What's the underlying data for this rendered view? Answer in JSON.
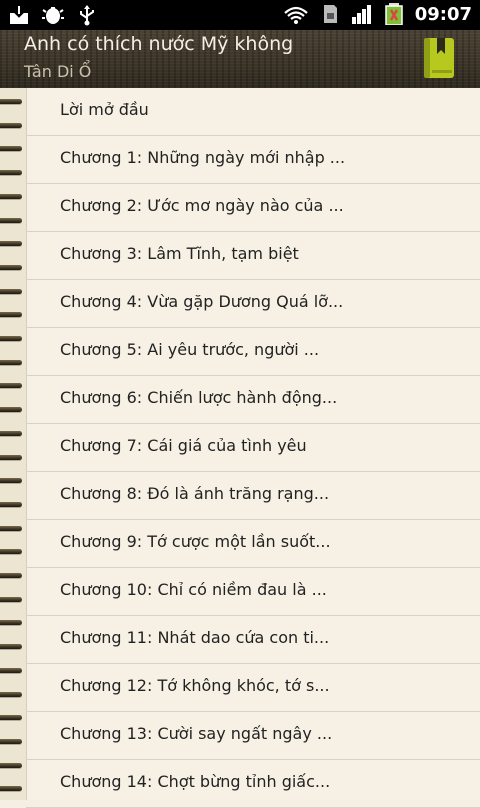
{
  "status_bar": {
    "icons_left": [
      "download-icon",
      "android-debug-icon",
      "usb-icon"
    ],
    "icons_right": [
      "wifi-icon",
      "sd-card-icon",
      "signal-icon",
      "battery-charging-icon"
    ],
    "time": "09:07"
  },
  "header": {
    "title": "Anh có thích nước Mỹ không",
    "author": "Tân Di Ổ",
    "bookmark_icon": "bookmark-book-icon",
    "accent_color": "#b7c81e"
  },
  "chapters": [
    "Lời mở đầu",
    "Chương 1: Những ngày mới nhập ...",
    "Chương 2: Ước mơ ngày nào của ...",
    "Chương 3: Lâm Tĩnh, tạm biệt",
    "Chương 4: Vừa gặp Dương Quá lỡ...",
    "Chương 5: Ai yêu trước, người ...",
    "Chương 6: Chiến lược hành động...",
    "Chương 7: Cái giá của tình yêu",
    "Chương 8: Đó là ánh trăng rạng...",
    "Chương 9: Tớ cược một lần suốt...",
    "Chương 10: Chỉ có niềm đau là ...",
    "Chương 11: Nhát dao cứa con ti...",
    "Chương 12: Tớ không khóc, tớ s...",
    "Chương 13: Cười say ngất ngây ...",
    "Chương 14: Chợt bừng tỉnh giấc..."
  ]
}
